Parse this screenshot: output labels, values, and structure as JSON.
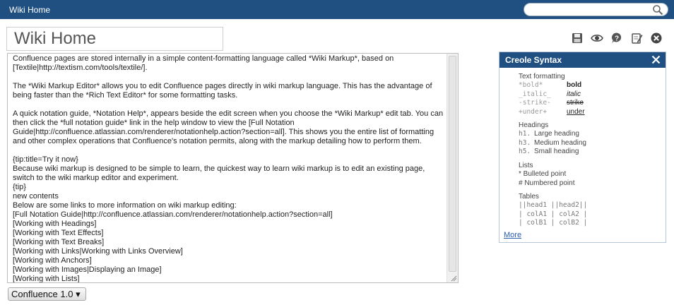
{
  "topbar": {
    "home_label": "Wiki Home",
    "search_value": ""
  },
  "title": {
    "value": "Wiki Home"
  },
  "toolbar": {
    "icons": [
      "save-icon",
      "preview-icon",
      "help-icon",
      "edit-icon",
      "close-icon"
    ]
  },
  "editor": {
    "content": "Confluence pages are stored internally in a simple content-formatting language called *Wiki Markup*, based on [Textile|http://textism.com/tools/textile/].\n\nThe *Wiki Markup Editor* allows you to edit Confluence pages directly in wiki markup language. This has the advantage of being faster than the *Rich Text Editor* for some formatting tasks.\n\nA quick notation guide, *Notation Help*, appears beside the edit screen when you choose the *Wiki Markup* edit tab. You can then click the *full notation guide* link in the help window to view the [Full Notation Guide|http://confluence.atlassian.com/renderer/notationhelp.action?section=all]. This shows you the entire list of formatting and other complex operations that Confluence's notation permits, along with the markup detailing how to perform them.\n\n{tip:title=Try it now}\nBecause wiki markup is designed to be simple to learn, the quickest way to learn wiki markup is to edit an existing page, switch to the wiki markup editor and experiment.\n{tip}\nnew contents\nBelow are some links to more information on wiki markup editing:\n[Full Notation Guide|http://confluence.atlassian.com/renderer/notationhelp.action?section=all]\n[Working with Headings]\n[Working with Text Effects]\n[Working with Text Breaks]\n[Working with Links|Working with Links Overview]\n[Working with Anchors]\n[Working with Images|Displaying an Image]\n[Working with Lists]"
  },
  "version_select": {
    "selected": "Confluence 1.0 ▾"
  },
  "creole": {
    "title": "Creole Syntax",
    "text_formatting": {
      "heading": "Text formatting",
      "rows": [
        {
          "markup": "*bold*",
          "result": "bold"
        },
        {
          "markup": "_italic_",
          "result": "italic"
        },
        {
          "markup": "-strike-",
          "result": "strike"
        },
        {
          "markup": "+under+",
          "result": "under"
        }
      ]
    },
    "headings": {
      "heading": "Headings",
      "rows": [
        {
          "markup": "h1.",
          "result": "Large heading"
        },
        {
          "markup": "h3.",
          "result": "Medium heading"
        },
        {
          "markup": "h5.",
          "result": "Small heading"
        }
      ]
    },
    "lists": {
      "heading": "Lists",
      "rows": [
        "* Bulleted point",
        "# Numbered point"
      ]
    },
    "tables": {
      "heading": "Tables",
      "rows": [
        "||head1 ||head2||",
        "| colA1 | colA2 |",
        "| colB1 | colB2 |"
      ]
    },
    "more_label": "More"
  }
}
